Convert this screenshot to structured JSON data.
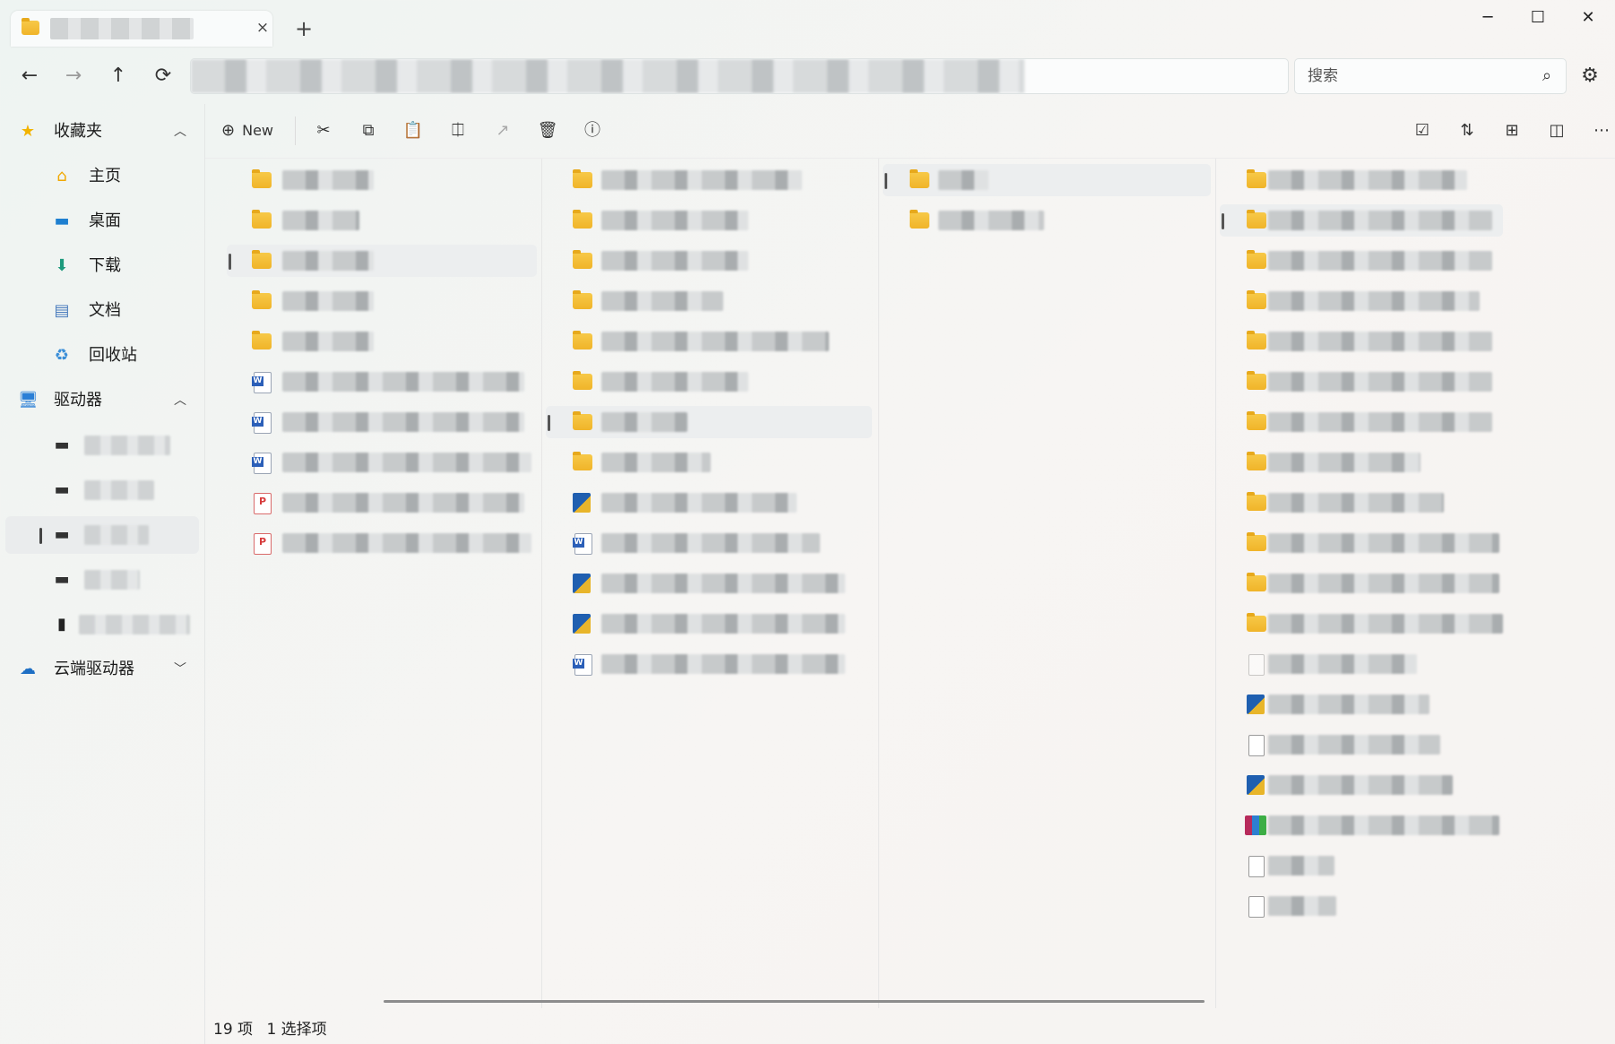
{
  "window": {
    "tab_close": "×",
    "new_tab": "+",
    "minimize": "─",
    "maximize": "☐",
    "close": "✕"
  },
  "nav": {
    "back": "←",
    "forward": "→",
    "up": "↑",
    "refresh": "⟳"
  },
  "search": {
    "placeholder": "搜索"
  },
  "sidebar": {
    "favorites_label": "收藏夹",
    "favorites_items": [
      "主页",
      "桌面",
      "下载",
      "文档",
      "回收站"
    ],
    "drives_label": "驱动器",
    "cloud_label": "云端驱动器"
  },
  "toolbar": {
    "new_label": "New"
  },
  "status": {
    "item_count": "19 项",
    "selection": "1 选择项"
  },
  "colors": {
    "folder": "#f0b429",
    "accent": "#1a66c7"
  }
}
